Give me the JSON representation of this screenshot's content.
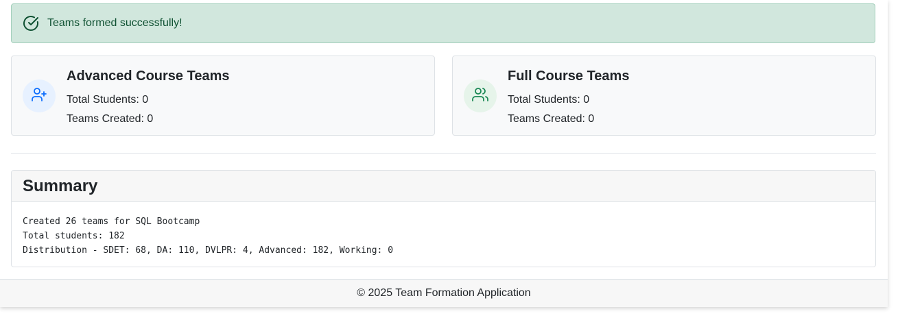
{
  "alert": {
    "message": "Teams formed successfully!",
    "icon": "check-circle-icon",
    "color": "#0f5132"
  },
  "cards": [
    {
      "title": "Advanced Course Teams",
      "icon": "user-plus-icon",
      "accent": "#0d6efd",
      "total_students": "Total Students: 0",
      "teams_created": "Teams Created: 0"
    },
    {
      "title": "Full Course Teams",
      "icon": "users-icon",
      "accent": "#198754",
      "total_students": "Total Students: 0",
      "teams_created": "Teams Created: 0"
    }
  ],
  "summary": {
    "title": "Summary",
    "lines": [
      "Created 26 teams for SQL Bootcamp",
      "Total students: 182",
      "Distribution - SDET: 68, DA: 110, DVLPR: 4, Advanced: 182, Working: 0"
    ]
  },
  "footer": {
    "text": "© 2025 Team Formation Application"
  }
}
